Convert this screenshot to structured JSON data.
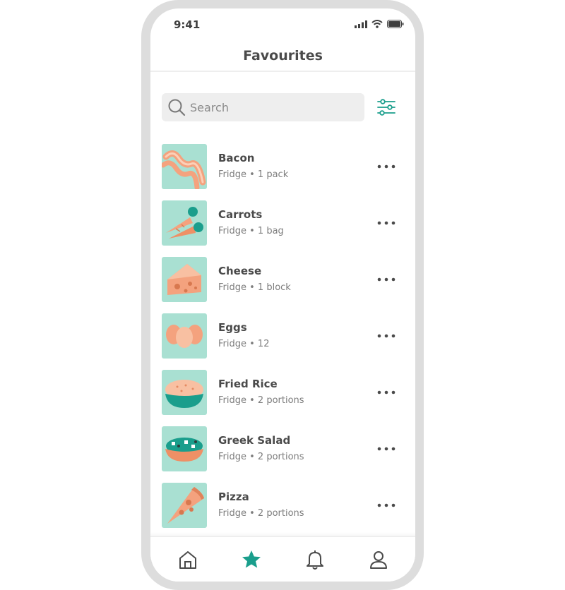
{
  "status_bar": {
    "time": "9:41",
    "icons": [
      "cellular-signal-icon",
      "wifi-icon",
      "battery-icon"
    ]
  },
  "header": {
    "title": "Favourites"
  },
  "search": {
    "placeholder": "Search",
    "icon": "search-icon"
  },
  "filter": {
    "icon": "filter-sliders-icon"
  },
  "items": [
    {
      "name": "Bacon",
      "meta": "Fridge • 1 pack",
      "icon": "bacon-icon"
    },
    {
      "name": "Carrots",
      "meta": "Fridge • 1 bag",
      "icon": "carrots-icon"
    },
    {
      "name": "Cheese",
      "meta": "Fridge • 1 block",
      "icon": "cheese-icon"
    },
    {
      "name": "Eggs",
      "meta": "Fridge • 12",
      "icon": "eggs-icon"
    },
    {
      "name": "Fried Rice",
      "meta": "Fridge • 2 portions",
      "icon": "fried-rice-icon"
    },
    {
      "name": "Greek Salad",
      "meta": "Fridge • 2 portions",
      "icon": "greek-salad-icon"
    },
    {
      "name": "Pizza",
      "meta": "Fridge • 2 portions",
      "icon": "pizza-icon"
    }
  ],
  "tab_bar": {
    "tabs": [
      {
        "name": "home",
        "icon": "home-icon",
        "active": false
      },
      {
        "name": "favourites",
        "icon": "star-icon",
        "active": true
      },
      {
        "name": "notifications",
        "icon": "bell-icon",
        "active": false
      },
      {
        "name": "profile",
        "icon": "user-icon",
        "active": false
      }
    ]
  },
  "colors": {
    "accent": "#1a9e8c",
    "thumb_bg": "#a9e0d2",
    "food_orange": "#f4a27e",
    "text_dark": "#4a4a4a",
    "text_muted": "#7d7d7d"
  }
}
